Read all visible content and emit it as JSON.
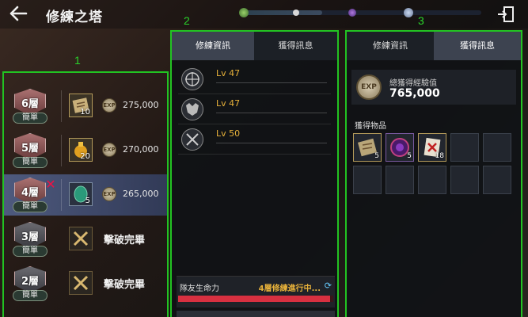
{
  "header": {
    "title": "修練之塔",
    "back_icon": "arrow-left-icon",
    "exit_icon": "exit-door-icon",
    "progress_fraction": 0.33
  },
  "section_markers": [
    "1",
    "2",
    "3"
  ],
  "floors": [
    {
      "floor": "6層",
      "difficulty": "簡單",
      "reward_count": "10",
      "exp": "275,000",
      "status": "reward"
    },
    {
      "floor": "5層",
      "difficulty": "簡單",
      "reward_count": "20",
      "exp": "270,000",
      "status": "reward"
    },
    {
      "floor": "4層",
      "difficulty": "簡單",
      "reward_count": "5",
      "exp": "265,000",
      "status": "selected"
    },
    {
      "floor": "3層",
      "difficulty": "簡單",
      "cleared_text": "擊破完畢",
      "status": "cleared"
    },
    {
      "floor": "2層",
      "difficulty": "簡單",
      "cleared_text": "擊破完畢",
      "status": "cleared"
    }
  ],
  "panel2": {
    "tabs": [
      {
        "label": "修練資訊",
        "active": true
      },
      {
        "label": "獲得訊息",
        "active": false
      }
    ],
    "members": [
      {
        "level": "Lv 47",
        "icon": "compass-emblem-icon"
      },
      {
        "level": "Lv 47",
        "icon": "beast-emblem-icon"
      },
      {
        "level": "Lv 50",
        "icon": "crossed-swords-icon"
      }
    ],
    "hp_label": "隊友生命力",
    "hp_status": "4層修練進行中...",
    "hp_fraction": 0.98
  },
  "panel3": {
    "tabs": [
      {
        "label": "修練資訊",
        "active": false
      },
      {
        "label": "獲得訊息",
        "active": true
      }
    ],
    "exp_title": "總獲得經驗值",
    "exp_value": "765,000",
    "items_title": "獲得物品",
    "items": [
      {
        "count": "5",
        "icon": "scroll-map-icon"
      },
      {
        "count": "5",
        "icon": "purple-gem-icon"
      },
      {
        "count": "18",
        "icon": "red-scroll-icon"
      },
      {
        "count": "",
        "icon": ""
      },
      {
        "count": "",
        "icon": ""
      },
      {
        "count": "",
        "icon": ""
      },
      {
        "count": "",
        "icon": ""
      },
      {
        "count": "",
        "icon": ""
      },
      {
        "count": "",
        "icon": ""
      },
      {
        "count": "",
        "icon": ""
      }
    ]
  },
  "exp_coin_label": "EXP",
  "colors": {
    "annotation_green": "#22c322",
    "level_gold": "#e8b23a",
    "hp_red": "#d73040",
    "selected_row": "#5a6ea0"
  }
}
